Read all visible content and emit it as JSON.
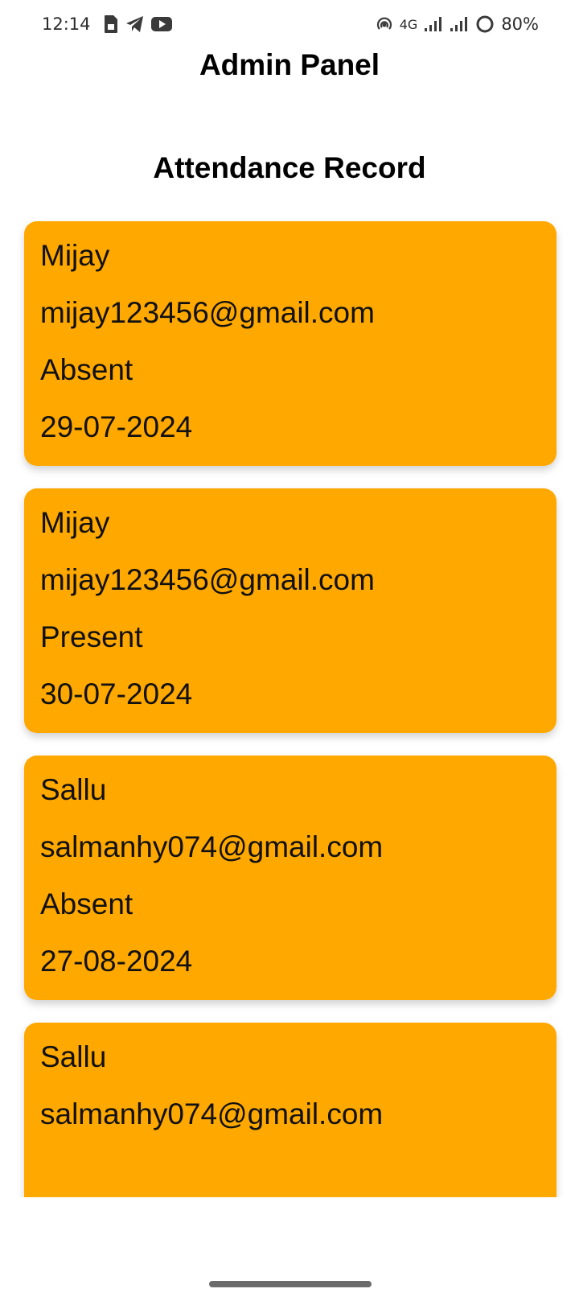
{
  "status_bar": {
    "time": "12:14",
    "network": "4G",
    "battery": "80%",
    "left_icons": [
      "sim-icon",
      "telegram-icon",
      "youtube-icon"
    ],
    "right_icons": [
      "hotspot-icon",
      "signal-icon",
      "signal-icon",
      "battery-ring-icon"
    ]
  },
  "header": {
    "title": "Admin Panel"
  },
  "section": {
    "title": "Attendance Record"
  },
  "records": [
    {
      "name": "Mijay",
      "email": "mijay123456@gmail.com",
      "status": "Absent",
      "date": "29-07-2024"
    },
    {
      "name": "Mijay",
      "email": "mijay123456@gmail.com",
      "status": "Present",
      "date": "30-07-2024"
    },
    {
      "name": "Sallu",
      "email": "salmanhy074@gmail.com",
      "status": "Absent",
      "date": "27-08-2024"
    },
    {
      "name": "Sallu",
      "email": "salmanhy074@gmail.com",
      "status": "",
      "date": ""
    }
  ],
  "colors": {
    "card_background": "#FFA800",
    "background": "#FFFFFF",
    "text": "#111111"
  }
}
